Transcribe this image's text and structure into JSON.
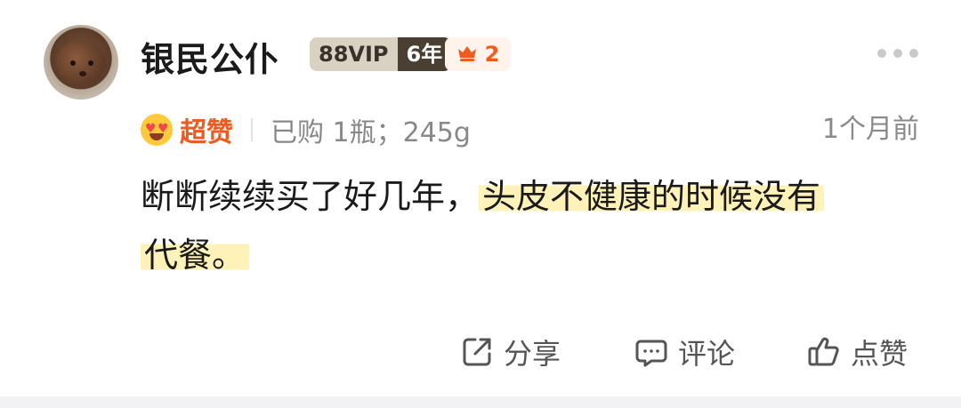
{
  "review": {
    "user": {
      "name": "银民公仆",
      "vip_label": "88VIP",
      "vip_years": "6年",
      "crown_count": "2"
    },
    "rating_text": "超赞",
    "purchase_info": "已购 1瓶；245g",
    "time_ago": "1个月前",
    "content": {
      "part1": "断断续续买了好几年，",
      "highlight1": "头皮不健康的时候没有",
      "highlight2": "代餐。"
    },
    "actions": {
      "share_label": "分享",
      "comment_label": "评论",
      "like_label": "点赞"
    }
  },
  "icons": {
    "avatar": "dog-avatar",
    "crown": "crown-icon",
    "rating": "heart-eyes-emoji",
    "more": "more-icon",
    "share": "share-icon",
    "comment": "comment-icon",
    "like": "thumbs-up-icon"
  },
  "colors": {
    "accent": "#f05a1e",
    "highlight": "#fff2b8",
    "vip_dark": "#4a3f33",
    "vip_light": "#d9d2c3",
    "muted_text": "#888888"
  }
}
